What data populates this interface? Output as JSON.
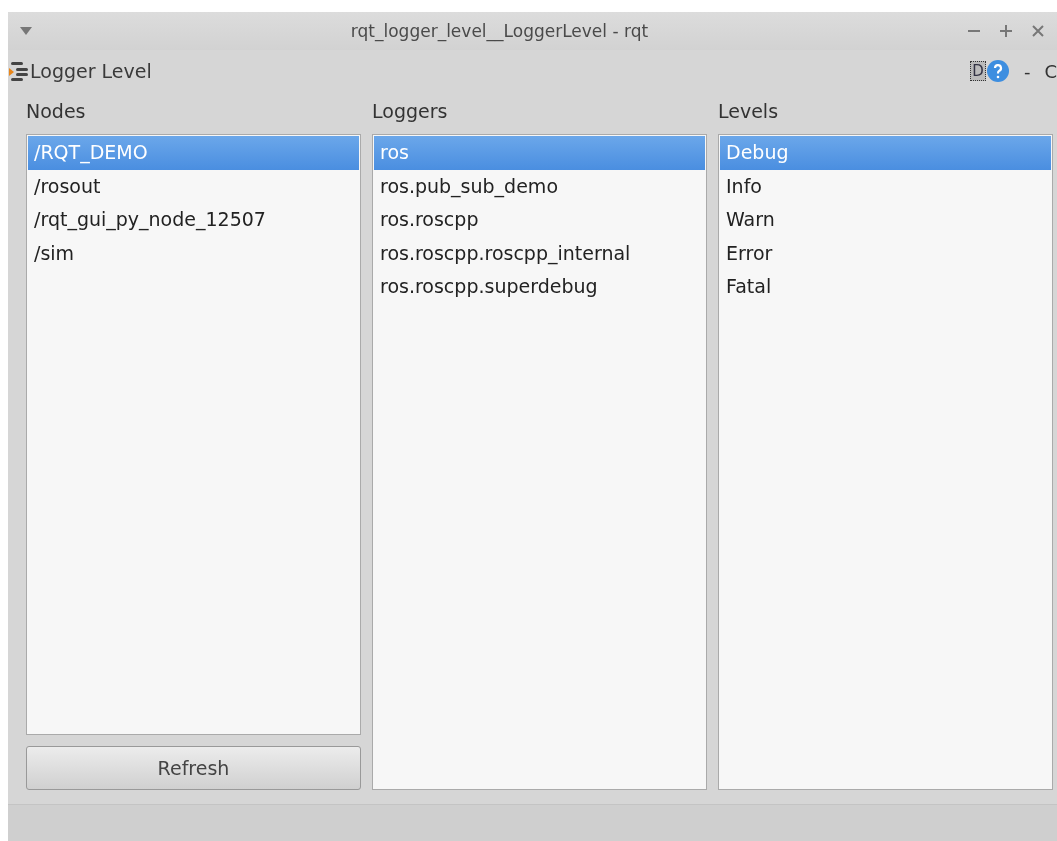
{
  "window": {
    "title": "rqt_logger_level__LoggerLevel - rqt"
  },
  "plugin": {
    "title": "Logger Level",
    "d_button": "D",
    "dash": "-",
    "close_cut": "C"
  },
  "nodes": {
    "label": "Nodes",
    "items": [
      {
        "text": "/RQT_DEMO",
        "selected": true
      },
      {
        "text": "/rosout",
        "selected": false
      },
      {
        "text": "/rqt_gui_py_node_12507",
        "selected": false
      },
      {
        "text": "/sim",
        "selected": false
      }
    ],
    "refresh": "Refresh"
  },
  "loggers": {
    "label": "Loggers",
    "items": [
      {
        "text": "ros",
        "selected": true
      },
      {
        "text": "ros.pub_sub_demo",
        "selected": false
      },
      {
        "text": "ros.roscpp",
        "selected": false
      },
      {
        "text": "ros.roscpp.roscpp_internal",
        "selected": false
      },
      {
        "text": "ros.roscpp.superdebug",
        "selected": false
      }
    ]
  },
  "levels": {
    "label": "Levels",
    "items": [
      {
        "text": "Debug",
        "selected": true
      },
      {
        "text": "Info",
        "selected": false
      },
      {
        "text": "Warn",
        "selected": false
      },
      {
        "text": "Error",
        "selected": false
      },
      {
        "text": "Fatal",
        "selected": false
      }
    ]
  }
}
